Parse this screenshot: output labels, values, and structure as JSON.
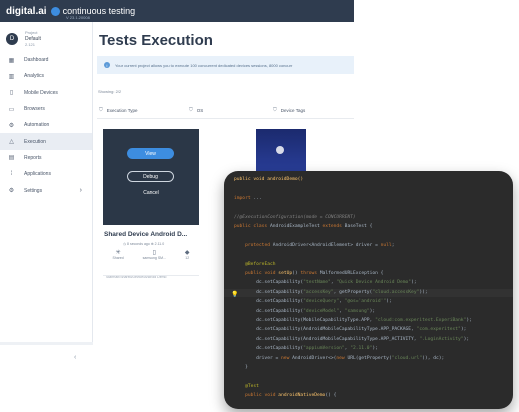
{
  "topbar": {
    "brand": "digital.ai",
    "product": "continuous testing",
    "version": "V 23.1.20008"
  },
  "project": {
    "avatar_letter": "D",
    "label": "Project",
    "name": "Default",
    "count": "2.121"
  },
  "sidebar": {
    "items": [
      {
        "label": "Dashboard",
        "icon": "dashboard-icon",
        "glyph": "▦"
      },
      {
        "label": "Analytics",
        "icon": "analytics-icon",
        "glyph": "▥"
      },
      {
        "label": "Mobile Devices",
        "icon": "mobile-icon",
        "glyph": "▯"
      },
      {
        "label": "Browsers",
        "icon": "browser-icon",
        "glyph": "▭"
      },
      {
        "label": "Automation",
        "icon": "automation-icon",
        "glyph": "⚙"
      },
      {
        "label": "Execution",
        "icon": "execution-icon",
        "glyph": "△"
      },
      {
        "label": "Reports",
        "icon": "reports-icon",
        "glyph": "▤"
      },
      {
        "label": "Applications",
        "icon": "applications-icon",
        "glyph": "⁞"
      },
      {
        "label": "Settings",
        "icon": "settings-icon",
        "glyph": "⚙",
        "chevron": "›"
      }
    ],
    "collapse_glyph": "‹"
  },
  "main": {
    "title": "Tests Execution",
    "banner": "Your current project allows you to execute 100 concurrent dedicated devices sessions, 8000 concurr",
    "showing": "Showing: 2/2",
    "filters": [
      "Execution Type",
      "OS",
      "Device Tags"
    ]
  },
  "device_card": {
    "view_label": "View",
    "debug_label": "Debug",
    "cancel_label": "Cancel",
    "name": "Shared Device Android D...",
    "meta": "◷ 8 seconds ago    ⊕ 2.11.0",
    "icons": [
      {
        "label": "Shared",
        "glyph": "✳"
      },
      {
        "label": "samsung SM...",
        "glyph": "▯"
      },
      {
        "label": "12",
        "glyph": "◆"
      }
    ],
    "footer": "Starman/Shared/Device/Android Demo"
  },
  "code": {
    "lines": [
      {
        "html": "<span class='fn'>public void androidDemo()</span>"
      },
      {
        "html": ""
      },
      {
        "html": "<span class='kw'>import</span> ..."
      },
      {
        "html": ""
      },
      {
        "html": "<span class='cm'>//@ExecutionConfiguration(mode = CONCURRENT)</span>"
      },
      {
        "html": "<span class='kw'>public class</span> AndroidExampleTest <span class='kw'>extends</span> BaseTest {"
      },
      {
        "html": ""
      },
      {
        "html": "    <span class='kw'>protected</span> AndroidDriver&lt;AndroidElement&gt; driver = <span class='kw'>null</span>;"
      },
      {
        "html": ""
      },
      {
        "html": "    <span class='ann'>@BeforeEach</span>"
      },
      {
        "html": "    <span class='kw'>public void</span> <span class='fn'>setUp</span>() <span class='kw'>throws</span> MalformedURLException {"
      },
      {
        "html": "        dc.setCapability(<span class='str'>\"testName\"</span>, <span class='str'>\"Quick Device Android Demo\"</span>);"
      },
      {
        "html": "        dc.setCapability(<span class='str'>\"accessKey\"</span>, getProperty(<span class='str'>\"cloud.accessKey\"</span>));"
      },
      {
        "html": "        dc.setCapability(<span class='str'>\"deviceQuery\"</span>, <span class='str'>\"@os='android'\"</span>);"
      },
      {
        "html": "        dc.setCapability(<span class='str'>\"deviceModel\"</span>, <span class='str'>\"samsung\"</span>);"
      },
      {
        "html": "        dc.setCapability(MobileCapabilityType.APP, <span class='str'>\"cloud:com.experitest.ExperiBank\"</span>);"
      },
      {
        "html": "        dc.setCapability(AndroidMobileCapabilityType.APP_PACKAGE, <span class='str'>\"com.experitest\"</span>);"
      },
      {
        "html": "        dc.setCapability(AndroidMobileCapabilityType.APP_ACTIVITY, <span class='str'>\".LoginActivity\"</span>);"
      },
      {
        "html": "        dc.setCapability(<span class='str'>\"appiumVersion\"</span>, <span class='str'>\"2.11.0\"</span>);"
      },
      {
        "html": "        driver = <span class='kw'>new</span> AndroidDriver&lt;&gt;(<span class='kw'>new</span> URL(getProperty(<span class='str'>\"cloud.url\"</span>)), dc);"
      },
      {
        "html": "    }"
      },
      {
        "html": ""
      },
      {
        "html": "    <span class='ann'>@Test</span>"
      },
      {
        "html": "    <span class='kw'>public void</span> <span class='fn'>androidNativeDemo</span>() {"
      }
    ]
  },
  "colors": {
    "topbar": "#2f3c4f",
    "accent": "#3d8de0",
    "code_bg": "#2b2b2b"
  }
}
